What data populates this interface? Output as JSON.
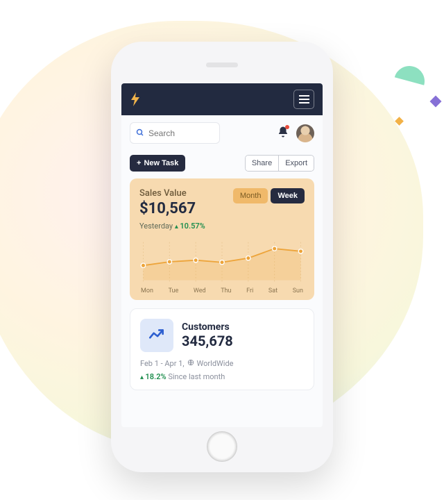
{
  "search": {
    "placeholder": "Search"
  },
  "actions": {
    "new_task": "New Task",
    "share": "Share",
    "export": "Export"
  },
  "sales": {
    "title": "Sales Value",
    "value": "$10,567",
    "toggle": {
      "month": "Month",
      "week": "Week",
      "active": "week"
    },
    "since_label": "Yesterday",
    "change_direction": "up",
    "change_pct": "10.57%"
  },
  "chart_data": {
    "type": "line",
    "categories": [
      "Mon",
      "Tue",
      "Wed",
      "Thu",
      "Fri",
      "Sat",
      "Sun"
    ],
    "values": [
      28,
      35,
      38,
      34,
      42,
      60,
      55
    ],
    "title": "",
    "xlabel": "",
    "ylabel": "",
    "ylim": [
      0,
      70
    ]
  },
  "customers": {
    "title": "Customers",
    "value": "345,678",
    "period": "Feb 1 - Apr 1,",
    "scope": "WorldWide",
    "change_pct": "18.2%",
    "change_label": "Since last month",
    "change_direction": "up"
  }
}
